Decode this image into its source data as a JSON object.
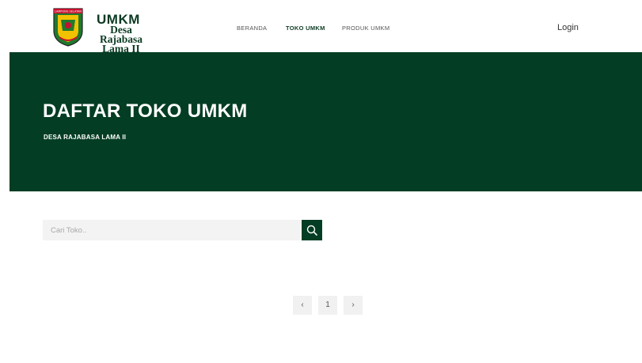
{
  "brand": {
    "emblem_text": "LAMPUNG SELATAN",
    "title": "UMKM",
    "subtitle_line1": "Desa Rajabasa",
    "subtitle_line2": "Lama II"
  },
  "nav": {
    "items": [
      {
        "label": "BERANDA"
      },
      {
        "label": "TOKO UMKM"
      },
      {
        "label": "PRODUK UMKM"
      }
    ],
    "active": "TOKO UMKM",
    "login": "Login"
  },
  "hero": {
    "title": "DAFTAR TOKO UMKM",
    "subtitle": "DESA RAJABASA LAMA II"
  },
  "search": {
    "placeholder": "Cari Toko..",
    "value": ""
  },
  "pagination": {
    "prev": "‹",
    "current": "1",
    "next": "›"
  },
  "colors": {
    "primary": "#033d23",
    "surface": "#f3f3f3"
  }
}
